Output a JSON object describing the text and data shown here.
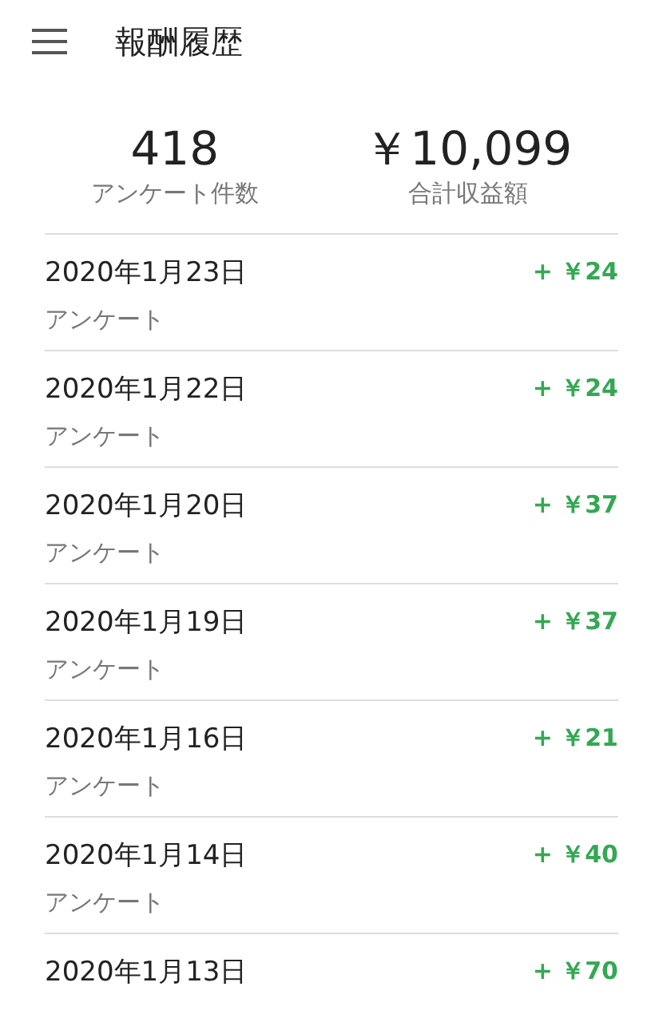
{
  "app_bar": {
    "title": "報酬履歴"
  },
  "summary": [
    {
      "value": "418",
      "label": "アンケート件数"
    },
    {
      "value": "￥10,099",
      "label": "合計収益額"
    }
  ],
  "history": [
    {
      "date": "2020年1月23日",
      "type": "アンケート",
      "amount": "+ ￥24"
    },
    {
      "date": "2020年1月22日",
      "type": "アンケート",
      "amount": "+ ￥24"
    },
    {
      "date": "2020年1月20日",
      "type": "アンケート",
      "amount": "+ ￥37"
    },
    {
      "date": "2020年1月19日",
      "type": "アンケート",
      "amount": "+ ￥37"
    },
    {
      "date": "2020年1月16日",
      "type": "アンケート",
      "amount": "+ ￥21"
    },
    {
      "date": "2020年1月14日",
      "type": "アンケート",
      "amount": "+ ￥40"
    },
    {
      "date": "2020年1月13日",
      "amount": "+ ￥70"
    }
  ]
}
